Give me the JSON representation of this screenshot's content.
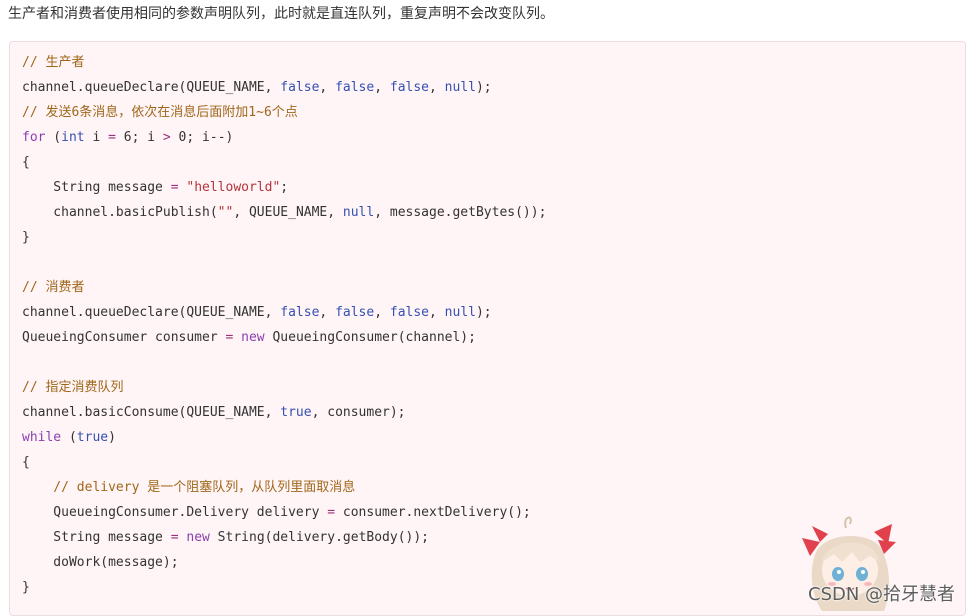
{
  "intro_text": "生产者和消费者使用相同的参数声明队列，此时就是直连队列，重复声明不会改变队列。",
  "code_lines": [
    [
      {
        "t": "// 生产者",
        "c": "comment"
      }
    ],
    [
      {
        "t": "channel.queueDeclare(QUEUE_NAME, ",
        "c": "plain"
      },
      {
        "t": "false",
        "c": "lit"
      },
      {
        "t": ", ",
        "c": "plain"
      },
      {
        "t": "false",
        "c": "lit"
      },
      {
        "t": ", ",
        "c": "plain"
      },
      {
        "t": "false",
        "c": "lit"
      },
      {
        "t": ", ",
        "c": "plain"
      },
      {
        "t": "null",
        "c": "lit"
      },
      {
        "t": ");",
        "c": "plain"
      }
    ],
    [
      {
        "t": "// 发送6条消息，依次在消息后面附加1~6个点",
        "c": "comment"
      }
    ],
    [
      {
        "t": "for",
        "c": "kw"
      },
      {
        "t": " (",
        "c": "plain"
      },
      {
        "t": "int",
        "c": "lit"
      },
      {
        "t": " i ",
        "c": "plain"
      },
      {
        "t": "=",
        "c": "op"
      },
      {
        "t": " 6; i ",
        "c": "plain"
      },
      {
        "t": ">",
        "c": "op"
      },
      {
        "t": " 0; i--)",
        "c": "plain"
      }
    ],
    [
      {
        "t": "{",
        "c": "plain"
      }
    ],
    [
      {
        "t": "    String message ",
        "c": "plain"
      },
      {
        "t": "=",
        "c": "op"
      },
      {
        "t": " ",
        "c": "plain"
      },
      {
        "t": "\"helloworld\"",
        "c": "str"
      },
      {
        "t": ";",
        "c": "plain"
      }
    ],
    [
      {
        "t": "    channel.basicPublish(",
        "c": "plain"
      },
      {
        "t": "\"\"",
        "c": "str"
      },
      {
        "t": ", QUEUE_NAME, ",
        "c": "plain"
      },
      {
        "t": "null",
        "c": "lit"
      },
      {
        "t": ", message.getBytes());",
        "c": "plain"
      }
    ],
    [
      {
        "t": "}",
        "c": "plain"
      }
    ],
    [],
    [
      {
        "t": "// 消费者",
        "c": "comment"
      }
    ],
    [
      {
        "t": "channel.queueDeclare(QUEUE_NAME, ",
        "c": "plain"
      },
      {
        "t": "false",
        "c": "lit"
      },
      {
        "t": ", ",
        "c": "plain"
      },
      {
        "t": "false",
        "c": "lit"
      },
      {
        "t": ", ",
        "c": "plain"
      },
      {
        "t": "false",
        "c": "lit"
      },
      {
        "t": ", ",
        "c": "plain"
      },
      {
        "t": "null",
        "c": "lit"
      },
      {
        "t": ");",
        "c": "plain"
      }
    ],
    [
      {
        "t": "QueueingConsumer consumer ",
        "c": "plain"
      },
      {
        "t": "=",
        "c": "op"
      },
      {
        "t": " ",
        "c": "plain"
      },
      {
        "t": "new",
        "c": "kw"
      },
      {
        "t": " QueueingConsumer(channel);",
        "c": "plain"
      }
    ],
    [],
    [
      {
        "t": "// 指定消费队列",
        "c": "comment"
      }
    ],
    [
      {
        "t": "channel.basicConsume(QUEUE_NAME, ",
        "c": "plain"
      },
      {
        "t": "true",
        "c": "lit"
      },
      {
        "t": ", consumer);",
        "c": "plain"
      }
    ],
    [
      {
        "t": "while",
        "c": "kw"
      },
      {
        "t": " (",
        "c": "plain"
      },
      {
        "t": "true",
        "c": "lit"
      },
      {
        "t": ")",
        "c": "plain"
      }
    ],
    [
      {
        "t": "{",
        "c": "plain"
      }
    ],
    [
      {
        "t": "    // delivery 是一个阻塞队列，从队列里面取消息",
        "c": "comment"
      }
    ],
    [
      {
        "t": "    QueueingConsumer.Delivery delivery ",
        "c": "plain"
      },
      {
        "t": "=",
        "c": "op"
      },
      {
        "t": " consumer.nextDelivery();",
        "c": "plain"
      }
    ],
    [
      {
        "t": "    String message ",
        "c": "plain"
      },
      {
        "t": "=",
        "c": "op"
      },
      {
        "t": " ",
        "c": "plain"
      },
      {
        "t": "new",
        "c": "kw"
      },
      {
        "t": " String(delivery.getBody());",
        "c": "plain"
      }
    ],
    [
      {
        "t": "    doWork(message);",
        "c": "plain"
      }
    ],
    [
      {
        "t": "}",
        "c": "plain"
      }
    ]
  ],
  "watermark_text": "CSDN @拾牙慧者",
  "mascot_icon": "anime-girl-mascot-icon",
  "colors": {
    "code_background": "#fff4f6",
    "comment": "#a0671a",
    "keyword": "#8c3fb0",
    "literal": "#3451b2",
    "string": "#b3343a",
    "operator": "#9a2f7a"
  }
}
